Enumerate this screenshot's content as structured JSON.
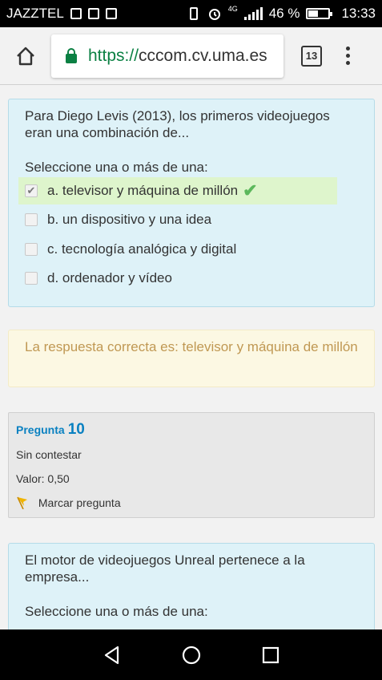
{
  "status_bar": {
    "carrier": "JAZZTEL",
    "network": "4G",
    "battery": "46 %",
    "time": "13:33"
  },
  "browser": {
    "url_scheme": "https://",
    "url_host": "cccom.cv.uma.es",
    "tab_count": "13"
  },
  "question1": {
    "text": "Para Diego Levis (2013), los primeros videojuegos eran una combinación de...",
    "prompt": "Seleccione una o más de una:",
    "choices": [
      {
        "label": "a. televisor y máquina de millón",
        "checked": true,
        "correct": true
      },
      {
        "label": "b. un dispositivo y una idea",
        "checked": false
      },
      {
        "label": "c. tecnología analógica y digital",
        "checked": false
      },
      {
        "label": "d. ordenador y vídeo",
        "checked": false
      }
    ]
  },
  "feedback": {
    "text": "La respuesta correcta es: televisor y máquina de millón"
  },
  "question_info": {
    "label": "Pregunta",
    "number": "10",
    "status": "Sin contestar",
    "value": "Valor: 0,50",
    "flag_label": "Marcar pregunta"
  },
  "question2": {
    "text": "El motor de videojuegos Unreal pertenece a la empresa...",
    "prompt": "Seleccione una o más de una:"
  },
  "colors": {
    "question_bg": "#def2f8",
    "correct_bg": "#def5cc",
    "feedback_bg": "#fcf8e3",
    "feedback_text": "#c09853",
    "link_blue": "#0a81c1",
    "url_green": "#0b8043"
  }
}
